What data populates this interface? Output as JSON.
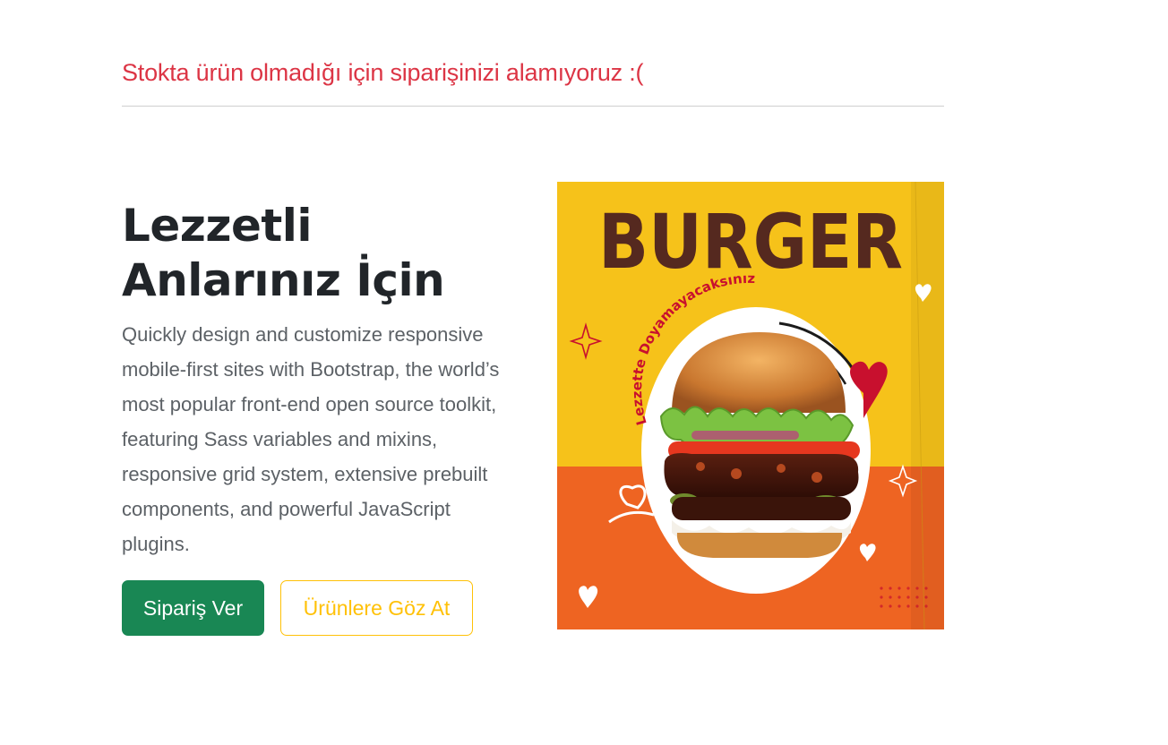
{
  "alert": {
    "message": "Stokta ürün olmadığı için siparişinizi alamıyoruz :("
  },
  "hero": {
    "title": "Lezzetli Anlarınız İçin",
    "description": "Quickly design and customize responsive mobile-first sites with Bootstrap, the world’s most popular front-end open source toolkit, featuring Sass variables and mixins, responsive grid system, extensive prebuilt components, and powerful JavaScript plugins.",
    "primary_button": "Sipariş Ver",
    "secondary_button": "Ürünlere Göz At"
  },
  "promo_image": {
    "headline": "BURGER",
    "tagline": "Lezzette Doyamayacaksınız"
  },
  "colors": {
    "alert_text": "#dc3545",
    "primary_button": "#198754",
    "outline_button": "#ffc107",
    "heading_text": "#212529",
    "body_text": "#5c6166",
    "image_yellow": "#f6c21a",
    "image_orange": "#ee6422",
    "burger_headline": "#55291f"
  }
}
